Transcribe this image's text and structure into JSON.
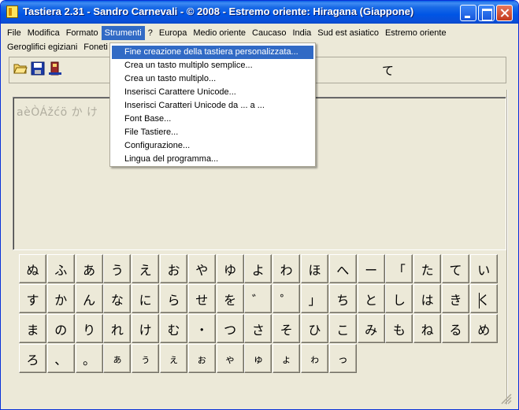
{
  "window": {
    "title": "Tastiera 2.31 - Sandro Carnevali - ©  2008 - Estremo oriente: Hiragana (Giappone)"
  },
  "menu": {
    "row1": [
      "File",
      "Modifica",
      "Formato",
      "Strumenti",
      "?",
      "Europa",
      "Medio oriente",
      "Caucaso",
      "India",
      "Sud est asiatico",
      "Estremo oriente"
    ],
    "row2": [
      "Geroglifici egiziani",
      "Foneti"
    ],
    "active": "Strumenti"
  },
  "toolbar": {
    "icons": [
      "open-folder-icon",
      "save-disk-icon",
      "figure-icon"
    ],
    "current_char": "て"
  },
  "text_area": {
    "sample": "aèÒÁžćö か け"
  },
  "keyboard": {
    "rows": [
      [
        "ぬ",
        "ふ",
        "あ",
        "う",
        "え",
        "お",
        "や",
        "ゆ",
        "よ",
        "わ",
        "ほ",
        "へ",
        "ー",
        "「",
        "た",
        "て",
        "い"
      ],
      [
        "す",
        "か",
        "ん",
        "な",
        "に",
        "ら",
        "せ",
        "を",
        "゛",
        "゜",
        "」",
        "ち",
        "と",
        "し",
        "は",
        "き",
        "く"
      ],
      [
        "ま",
        "の",
        "り",
        "れ",
        "け",
        "む",
        "・",
        "つ",
        "さ",
        "そ",
        "ひ",
        "こ",
        "み",
        "も",
        "ね",
        "る",
        "め"
      ],
      [
        "ろ",
        "、",
        "。",
        "ぁ",
        "ぅ",
        "ぇ",
        "ぉ",
        "ゃ",
        "ゅ",
        "ょ",
        "ゎ",
        "っ"
      ]
    ]
  },
  "strumenti_menu": {
    "items": [
      "Fine creazione della tastiera personalizzata...",
      "Crea un tasto multiplo semplice...",
      "Crea un tasto multiplo...",
      "Inserisci Carattere Unicode...",
      "Inserisci Caratteri Unicode da ... a ...",
      "Font Base...",
      "File Tastiere...",
      "Configurazione...",
      "Lingua del programma..."
    ],
    "highlighted_index": 0
  }
}
